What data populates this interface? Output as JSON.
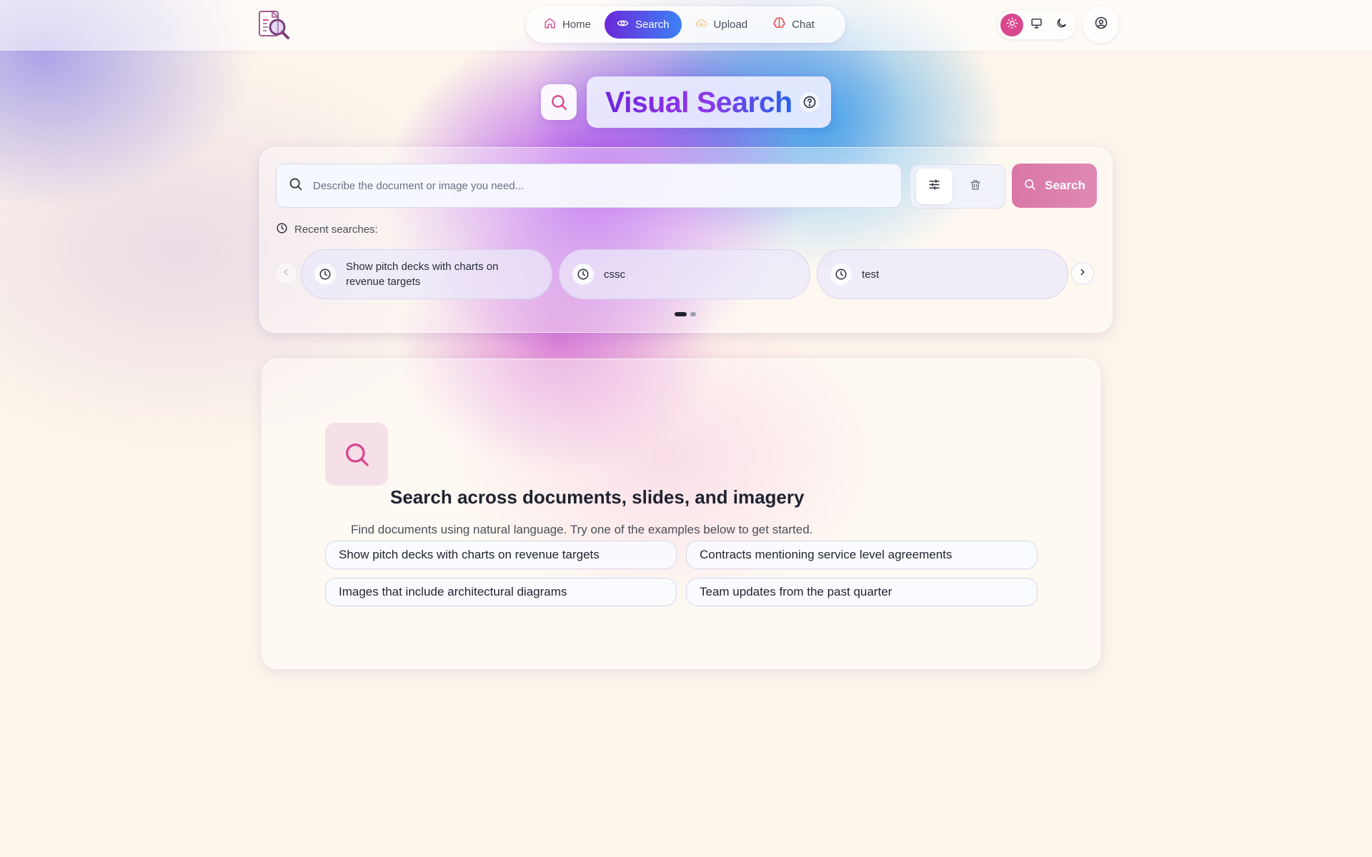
{
  "colors": {
    "accent_purple": "#6d28d9",
    "accent_blue": "#3b82f6",
    "accent_pink": "#d9488f",
    "search_button": "#d977a7"
  },
  "nav": {
    "items": [
      {
        "label": "Home",
        "icon": "home-icon",
        "active": false
      },
      {
        "label": "Search",
        "icon": "eye-icon",
        "active": true
      },
      {
        "label": "Upload",
        "icon": "cloud-upload-icon",
        "active": false
      },
      {
        "label": "Chat",
        "icon": "brain-icon",
        "active": false
      }
    ],
    "theme": {
      "options": [
        "light",
        "system",
        "dark"
      ],
      "selected": "light"
    }
  },
  "header": {
    "title_part1": "Visual",
    "title_part2": "Search"
  },
  "search": {
    "placeholder": "Describe the document or image you need...",
    "value": "",
    "button_label": "Search",
    "recent_label": "Recent searches:",
    "recent": [
      "Show pitch decks with charts on revenue targets",
      "cssc",
      "test"
    ],
    "page_indicator": {
      "current": 1,
      "total": 2
    }
  },
  "empty_state": {
    "title": "Search across documents, slides, and imagery",
    "subtitle": "Find documents using natural language. Try one of the examples below to get started.",
    "examples": [
      "Show pitch decks with charts on revenue targets",
      "Contracts mentioning service level agreements",
      "Images that include architectural diagrams",
      "Team updates from the past quarter"
    ]
  }
}
